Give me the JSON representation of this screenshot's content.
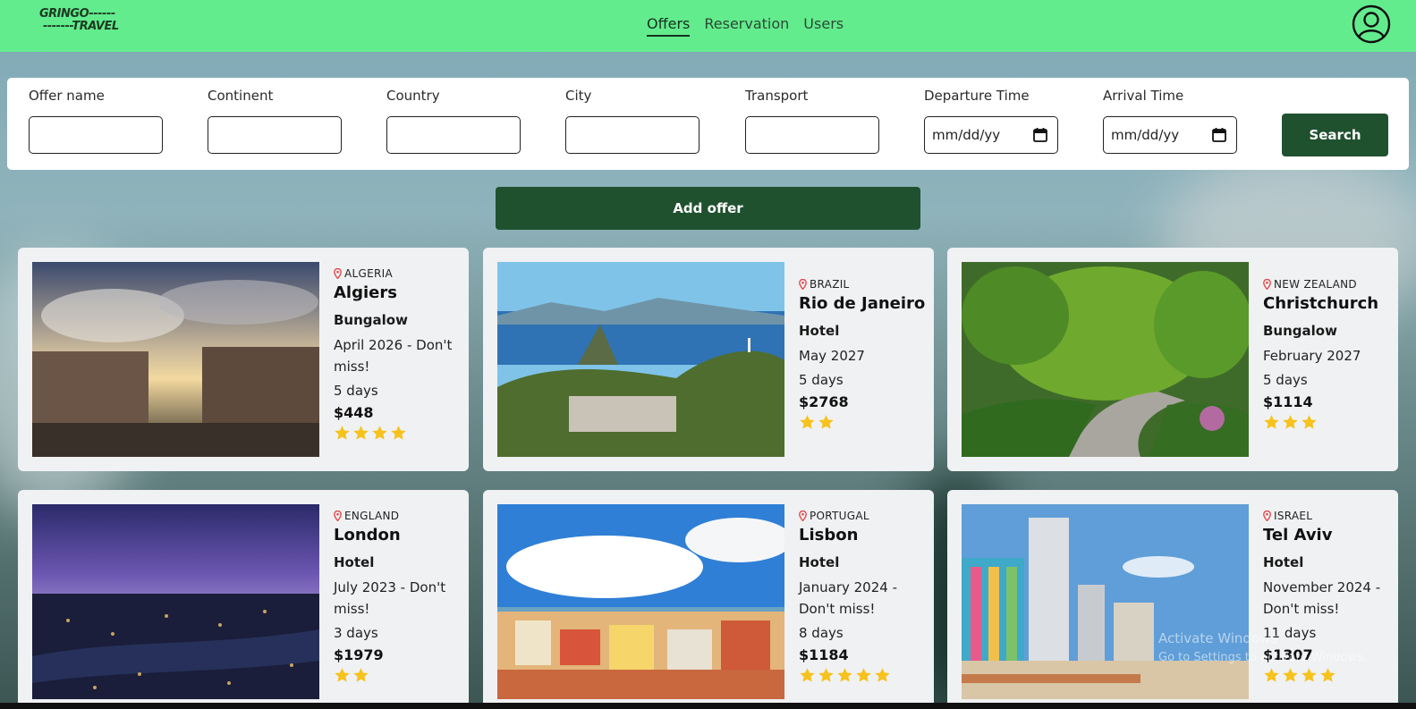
{
  "logo": {
    "line1": "GRINGO------",
    "line2": "-------TRAVEL"
  },
  "nav": {
    "offers": "Offers",
    "reservation": "Reservation",
    "users": "Users"
  },
  "search": {
    "fields": {
      "offer_name": "Offer name",
      "continent": "Continent",
      "country": "Country",
      "city": "City",
      "transport": "Transport",
      "departure_time": "Departure Time",
      "arrival_time": "Arrival Time"
    },
    "date_placeholder": "mm/dd/yy",
    "button": "Search"
  },
  "add_offer": "Add offer",
  "offers": [
    {
      "country": "ALGERIA",
      "city": "Algiers",
      "type": "Bungalow",
      "date": "April 2026 - Don't miss!",
      "days": "5 days",
      "price": "$448",
      "rating": 4
    },
    {
      "country": "BRAZIL",
      "city": "Rio de Janeiro",
      "type": "Hotel",
      "date": "May 2027",
      "days": "5 days",
      "price": "$2768",
      "rating": 2
    },
    {
      "country": "NEW ZEALAND",
      "city": "Christchurch",
      "type": "Bungalow",
      "date": "February 2027",
      "days": "5 days",
      "price": "$1114",
      "rating": 3
    },
    {
      "country": "ENGLAND",
      "city": "London",
      "type": "Hotel",
      "date": "July 2023 - Don't miss!",
      "days": "3 days",
      "price": "$1979",
      "rating": 2
    },
    {
      "country": "PORTUGAL",
      "city": "Lisbon",
      "type": "Hotel",
      "date": "January 2024 - Don't miss!",
      "days": "8 days",
      "price": "$1184",
      "rating": 5
    },
    {
      "country": "ISRAEL",
      "city": "Tel Aviv",
      "type": "Hotel",
      "date": "November 2024 - Don't miss!",
      "days": "11 days",
      "price": "$1307",
      "rating": 4
    }
  ],
  "watermark": {
    "line1": "Activate Windows",
    "line2": "Go to Settings to activate Windows."
  },
  "colors": {
    "nav_bg": "#63ec8d",
    "button_bg": "#20512f",
    "star": "#f6c21c",
    "pin": "#e24b4b"
  }
}
